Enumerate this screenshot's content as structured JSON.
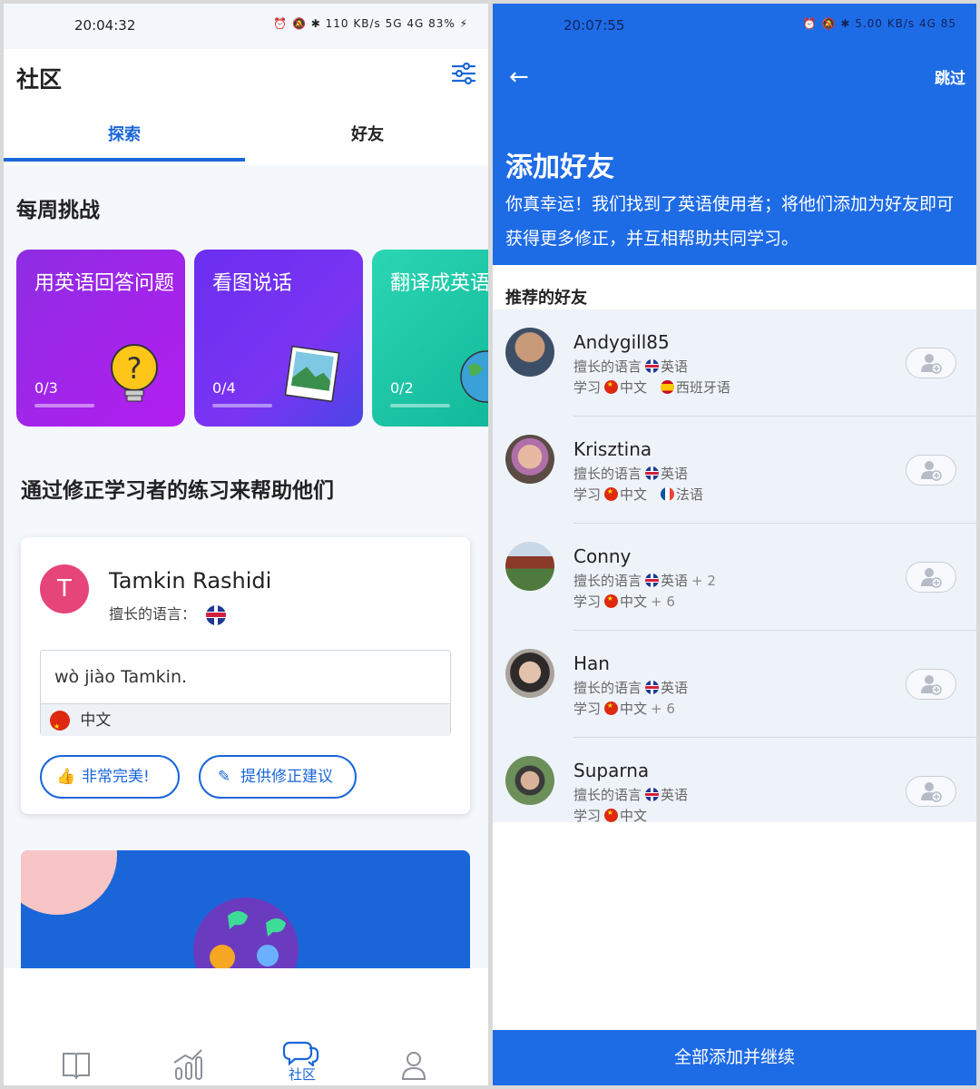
{
  "left": {
    "status": {
      "time": "20:04:32",
      "icons": "⏰ 🔕 ✱ 110 KB/s 5G 4G 83% ⚡"
    },
    "header": {
      "title": "社区"
    },
    "tabs": [
      {
        "label": "探索"
      },
      {
        "label": "好友"
      }
    ],
    "weekly": {
      "title": "每周挑战",
      "challenges": [
        {
          "title": "用英语回答问题",
          "progress": "0/3"
        },
        {
          "title": "看图说话",
          "progress": "0/4"
        },
        {
          "title": "翻译成英语",
          "progress": "0/2"
        }
      ]
    },
    "help": {
      "title": "通过修正学习者的练习来帮助他们"
    },
    "card": {
      "avatar_letter": "T",
      "name": "Tamkin Rashidi",
      "lang_label": "擅长的语言：",
      "answer": "wò jiào Tamkin.",
      "answer_lang": "中文",
      "btn_perfect": "非常完美!",
      "btn_suggest": "提供修正建议"
    },
    "nav": {
      "active_label": "社区"
    }
  },
  "right": {
    "status": {
      "time": "20:07:55",
      "icons": "⏰ 🔕 ✱ 5.00 KB/s 4G 85"
    },
    "skip": "跳过",
    "title": "添加好友",
    "subtitle": "你真幸运！我们找到了英语使用者；将他们添加为好友即可获得更多修正，并互相帮助共同学习。",
    "rec_title": "推荐的好友",
    "friends": [
      {
        "name": "Andygill85",
        "speaks_label": "擅长的语言",
        "speaks": "英语",
        "speaks_extra": "",
        "learns_label": "学习",
        "learns": "中文",
        "learns2": "西班牙语",
        "learns_extra": ""
      },
      {
        "name": "Krisztina",
        "speaks_label": "擅长的语言",
        "speaks": "英语",
        "speaks_extra": "",
        "learns_label": "学习",
        "learns": "中文",
        "learns2": "法语",
        "learns_extra": ""
      },
      {
        "name": "Conny",
        "speaks_label": "擅长的语言",
        "speaks": "英语",
        "speaks_extra": "+ 2",
        "learns_label": "学习",
        "learns": "中文",
        "learns2": "",
        "learns_extra": "+ 6"
      },
      {
        "name": "Han",
        "speaks_label": "擅长的语言",
        "speaks": "英语",
        "speaks_extra": "",
        "learns_label": "学习",
        "learns": "中文",
        "learns2": "",
        "learns_extra": "+ 6"
      },
      {
        "name": "Suparna",
        "speaks_label": "擅长的语言",
        "speaks": "英语",
        "speaks_extra": "",
        "learns_label": "学习",
        "learns": "中文",
        "learns2": "",
        "learns_extra": ""
      }
    ],
    "cta": "全部添加并继续"
  }
}
